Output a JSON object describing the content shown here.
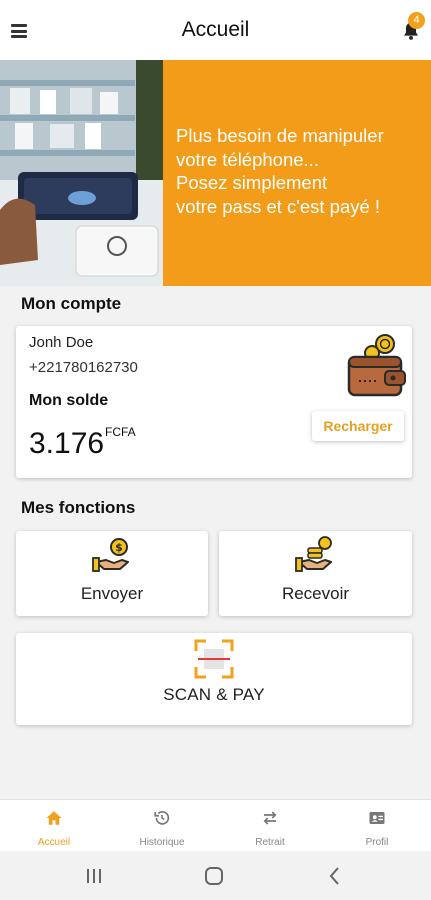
{
  "header": {
    "title": "Accueil",
    "notification_count": "4",
    "menu_icon": "hamburger-menu-icon",
    "bell_icon": "bell-icon"
  },
  "banner": {
    "text_lines": [
      "Plus besoin de manipuler",
      "votre téléphone...",
      "Posez simplement",
      "votre pass et c'est payé !"
    ],
    "slide_count": 3,
    "active_slide": 1,
    "background_color": "#f39c1a"
  },
  "account": {
    "section_title": "Mon compte",
    "name": "Jonh Doe",
    "phone": "+221780162730",
    "balance_label": "Mon solde",
    "balance": "3.176",
    "currency": "FCFA",
    "recharge_label": "Recharger",
    "wallet_icon": "wallet-icon"
  },
  "functions": {
    "section_title": "Mes fonctions",
    "items": [
      {
        "label": "Envoyer",
        "icon": "send-money-icon"
      },
      {
        "label": "Recevoir",
        "icon": "receive-money-icon"
      }
    ],
    "scan_label": "SCAN & PAY",
    "scan_icon": "scan-qr-icon"
  },
  "bottom_nav": {
    "items": [
      {
        "label": "Accueil",
        "icon": "home-icon",
        "active": true
      },
      {
        "label": "Historique",
        "icon": "history-icon",
        "active": false
      },
      {
        "label": "Retrait",
        "icon": "transfer-arrows-icon",
        "active": false
      },
      {
        "label": "Profil",
        "icon": "profile-card-icon",
        "active": false
      }
    ]
  },
  "colors": {
    "accent": "#f0a020",
    "nav_inactive": "#888888"
  }
}
